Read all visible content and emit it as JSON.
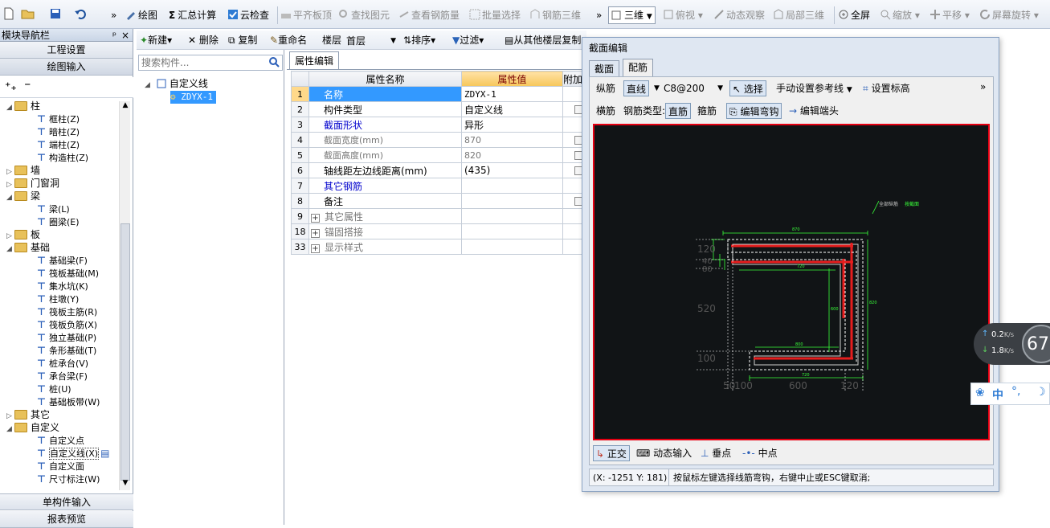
{
  "toolbar1": {
    "draw": "绘图",
    "sum": "汇总计算",
    "cloud_check": "云检查",
    "flush_slab": "平齐板顶",
    "find_element": "查找图元",
    "view_rebar": "查看钢筋量",
    "batch_select": "批量选择",
    "rebar_3d": "钢筋三维",
    "view_mode": "三维",
    "top_view": "俯视",
    "dynamic_view": "动态观察",
    "local_3d": "局部三维",
    "fullscreen": "全屏",
    "zoom": "缩放",
    "pan": "平移",
    "rotate": "屏幕旋转"
  },
  "nav": {
    "title": "模块导航栏",
    "pin": "ᵖ",
    "close": "×",
    "btn_project": "工程设置",
    "btn_draw": "绘图输入",
    "btn_single": "单构件输入",
    "btn_report": "报表预览",
    "tree": [
      {
        "label": "柱",
        "level": 0,
        "type": "folder",
        "open": true
      },
      {
        "label": "框柱(Z)",
        "level": 1,
        "type": "item"
      },
      {
        "label": "暗柱(Z)",
        "level": 1,
        "type": "item"
      },
      {
        "label": "端柱(Z)",
        "level": 1,
        "type": "item"
      },
      {
        "label": "构造柱(Z)",
        "level": 1,
        "type": "item"
      },
      {
        "label": "墙",
        "level": 0,
        "type": "folder",
        "open": false
      },
      {
        "label": "门窗洞",
        "level": 0,
        "type": "folder",
        "open": false
      },
      {
        "label": "梁",
        "level": 0,
        "type": "folder",
        "open": true
      },
      {
        "label": "梁(L)",
        "level": 1,
        "type": "item"
      },
      {
        "label": "圈梁(E)",
        "level": 1,
        "type": "item"
      },
      {
        "label": "板",
        "level": 0,
        "type": "folder",
        "open": false
      },
      {
        "label": "基础",
        "level": 0,
        "type": "folder",
        "open": true
      },
      {
        "label": "基础梁(F)",
        "level": 1,
        "type": "item"
      },
      {
        "label": "筏板基础(M)",
        "level": 1,
        "type": "item"
      },
      {
        "label": "集水坑(K)",
        "level": 1,
        "type": "item"
      },
      {
        "label": "柱墩(Y)",
        "level": 1,
        "type": "item"
      },
      {
        "label": "筏板主筋(R)",
        "level": 1,
        "type": "item"
      },
      {
        "label": "筏板负筋(X)",
        "level": 1,
        "type": "item"
      },
      {
        "label": "独立基础(P)",
        "level": 1,
        "type": "item"
      },
      {
        "label": "条形基础(T)",
        "level": 1,
        "type": "item"
      },
      {
        "label": "桩承台(V)",
        "level": 1,
        "type": "item"
      },
      {
        "label": "承台梁(F)",
        "level": 1,
        "type": "item"
      },
      {
        "label": "桩(U)",
        "level": 1,
        "type": "item"
      },
      {
        "label": "基础板带(W)",
        "level": 1,
        "type": "item"
      },
      {
        "label": "其它",
        "level": 0,
        "type": "folder",
        "open": false
      },
      {
        "label": "自定义",
        "level": 0,
        "type": "folder",
        "open": true
      },
      {
        "label": "自定义点",
        "level": 1,
        "type": "item"
      },
      {
        "label": "自定义线(X)",
        "level": 1,
        "type": "item",
        "selected": true
      },
      {
        "label": "自定义面",
        "level": 1,
        "type": "item"
      },
      {
        "label": "尺寸标注(W)",
        "level": 1,
        "type": "item"
      }
    ]
  },
  "toolbar2": {
    "new": "新建",
    "delete": "删除",
    "copy": "复制",
    "rename": "重命名",
    "floor_label": "楼层",
    "floor_value": "首层",
    "sort": "排序",
    "filter": "过滤",
    "copy_from": "从其他楼层复制"
  },
  "comp_tree": {
    "search_placeholder": "搜索构件...",
    "root": "自定义线",
    "child": "ZDYX-1"
  },
  "props": {
    "tab": "属性编辑",
    "col_name": "属性名称",
    "col_value": "属性值",
    "col_extra": "附加",
    "rows": [
      {
        "no": "1",
        "name": "名称",
        "value": "ZDYX-1",
        "style": "selected",
        "check": false
      },
      {
        "no": "2",
        "name": "构件类型",
        "value": "自定义线",
        "style": "normal",
        "check": true
      },
      {
        "no": "3",
        "name": "截面形状",
        "value": "异形",
        "style": "link",
        "check": false
      },
      {
        "no": "4",
        "name": "截面宽度(mm)",
        "value": "870",
        "style": "gray",
        "check": true
      },
      {
        "no": "5",
        "name": "截面高度(mm)",
        "value": "820",
        "style": "gray",
        "check": true
      },
      {
        "no": "6",
        "name": "轴线距左边线距离(mm)",
        "value": "(435)",
        "style": "normal",
        "check": true
      },
      {
        "no": "7",
        "name": "其它钢筋",
        "value": "",
        "style": "link",
        "check": false
      },
      {
        "no": "8",
        "name": "备注",
        "value": "",
        "style": "normal",
        "check": true
      },
      {
        "no": "9",
        "name": "其它属性",
        "value": "",
        "style": "group",
        "check": false
      },
      {
        "no": "18",
        "name": "锚固搭接",
        "value": "",
        "style": "group",
        "check": false
      },
      {
        "no": "33",
        "name": "显示样式",
        "value": "",
        "style": "group",
        "check": false
      }
    ]
  },
  "dialog": {
    "title": "截面编辑",
    "tab_section": "截面",
    "tab_rebar": "配筋",
    "long_rebar": "纵筋",
    "line_mode": "直线",
    "spec": "C8@200",
    "select": "选择",
    "manual_ref": "手动设置参考线",
    "set_elev": "设置标高",
    "more": "»",
    "trans_rebar": "横筋",
    "rebar_type": "钢筋类型:",
    "straight": "直筋",
    "stirrup": "箍筋",
    "edit_hook": "编辑弯钩",
    "edit_end": "编辑端头",
    "ortho": "正交",
    "dynamic_input": "动态输入",
    "perp_point": "垂点",
    "mid_point": "中点",
    "coords": "(X: -1251 Y: 181)",
    "hint": "按鼠标左键选择线筋弯钩，右键中止或ESC键取消;",
    "cad_label_all": "全部纵筋",
    "cad_label_val": "按截面",
    "dims": {
      "top_width": "870",
      "left_top": "120",
      "left_mid1": "40",
      "left_mid2": "80",
      "left_main": "520",
      "left_bottom": "100",
      "bottom_a": "50",
      "bottom_b": "100",
      "bottom_c": "600",
      "bottom_d": "120",
      "inner_top": "720",
      "inner_bottom": "720",
      "inner_right": "600",
      "right_total": "820",
      "bottom_label": "800"
    }
  },
  "netmon": {
    "up": "0.2",
    "down": "1.8",
    "unit": "K/s",
    "percent": "67"
  },
  "ime": {
    "lang": "中",
    "punct": "°,",
    "moon": "☽"
  },
  "colors": {
    "accent": "#3399ff",
    "selection": "#3399ff",
    "canvas_bg": "#111416",
    "canvas_border": "#e60012",
    "rebar_red": "#e61e1e",
    "dim_green": "#39ff3a",
    "link_blue": "#0000cc"
  }
}
